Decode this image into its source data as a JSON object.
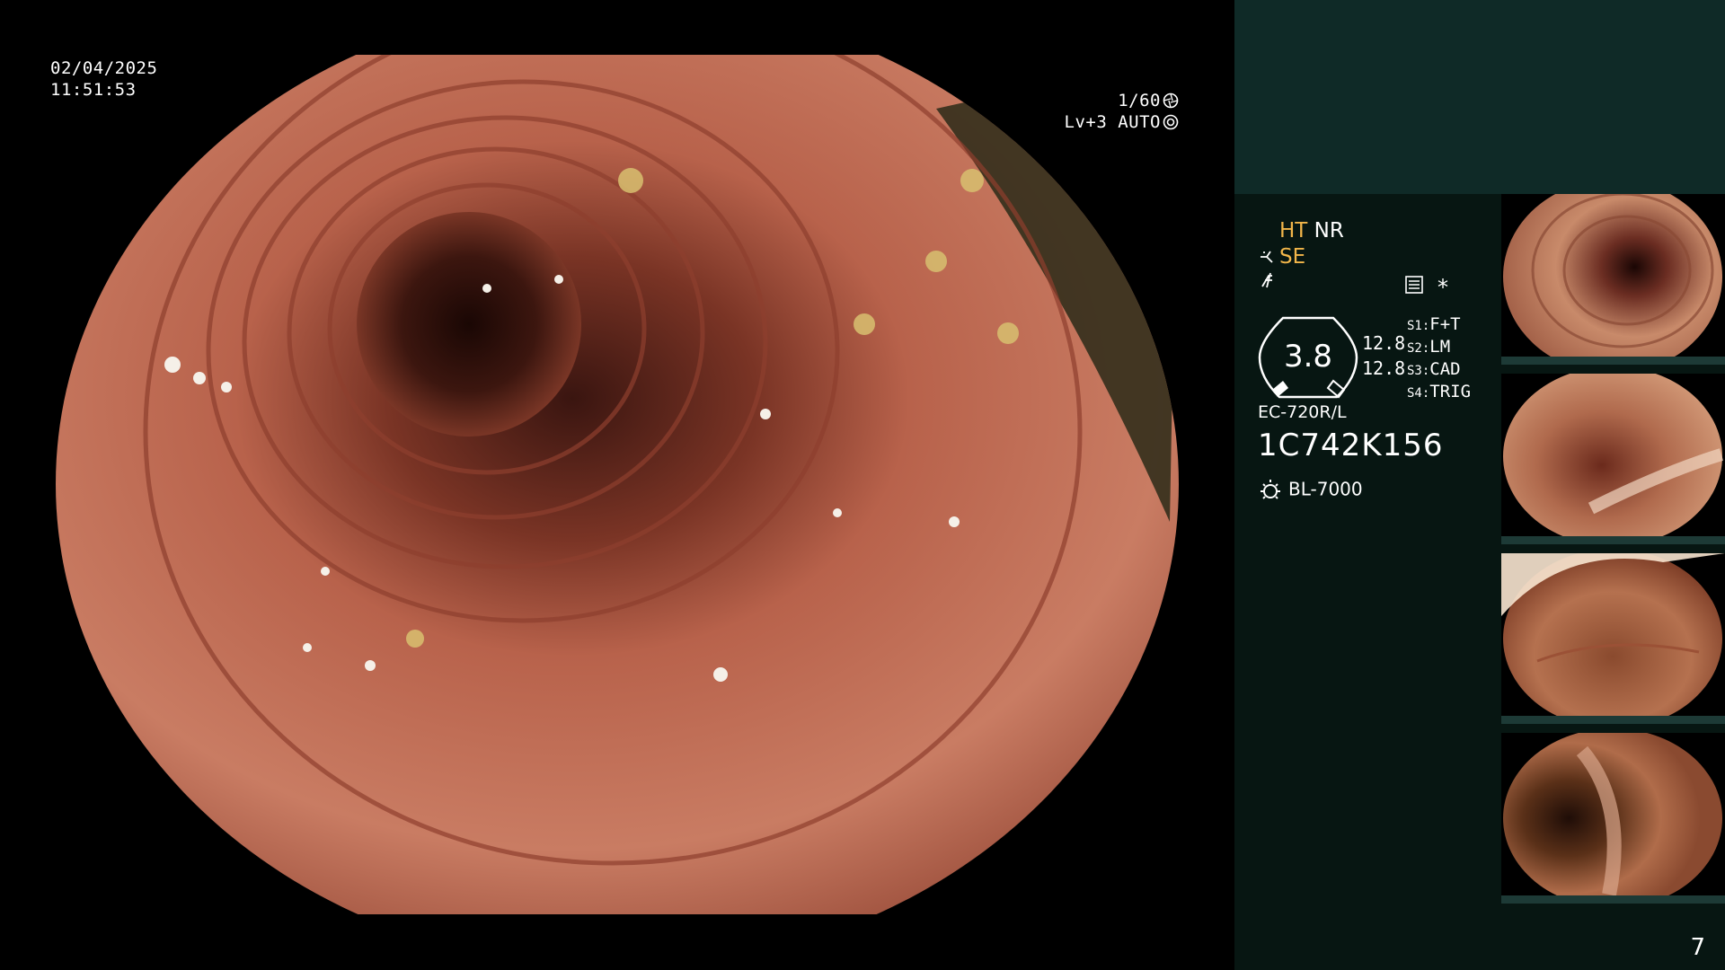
{
  "overlay": {
    "date": "02/04/2025",
    "time": "11:51:53",
    "shutter": "1/60",
    "iris": "Lv+3 AUTO"
  },
  "panel": {
    "ht": "HT",
    "nr": "NR",
    "se": "SE",
    "gauge_value": "3.8",
    "value_1": "12.8",
    "value_2": "12.8",
    "switches": [
      {
        "key": "S1:",
        "value": "F+T"
      },
      {
        "key": "S2:",
        "value": "LM"
      },
      {
        "key": "S3:",
        "value": "CAD"
      },
      {
        "key": "S4:",
        "value": "TRIG"
      }
    ],
    "scope_model": "EC-720R/L",
    "scope_serial": "1C742K156",
    "light_source": "BL-7000",
    "page_number": "7",
    "asterisk": "*"
  },
  "icons": {
    "shutter": "aperture-icon",
    "iris": "iris-icon",
    "se": "structure-enhance-icon",
    "signal": "signal-icon",
    "settings": "menu-settings-icon",
    "light": "light-bulb-icon"
  },
  "colors": {
    "accent_orange": "#f2b64a",
    "panel_top": "#0f2a27",
    "panel_bottom": "#071612"
  }
}
